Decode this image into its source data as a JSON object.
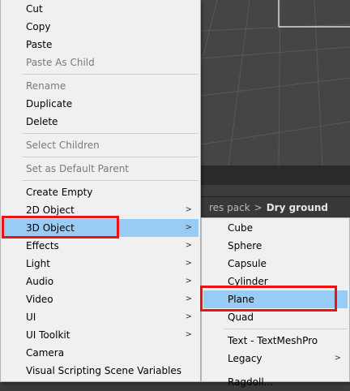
{
  "main_menu": {
    "items": [
      {
        "label": "Cut",
        "disabled": false
      },
      {
        "label": "Copy",
        "disabled": false
      },
      {
        "label": "Paste",
        "disabled": false
      },
      {
        "label": "Paste As Child",
        "disabled": true
      },
      {
        "label": "Rename",
        "disabled": true
      },
      {
        "label": "Duplicate",
        "disabled": false
      },
      {
        "label": "Delete",
        "disabled": false
      },
      {
        "label": "Select Children",
        "disabled": true
      },
      {
        "label": "Set as Default Parent",
        "disabled": true
      },
      {
        "label": "Create Empty",
        "disabled": false
      },
      {
        "label": "2D Object",
        "submenu": true
      },
      {
        "label": "3D Object",
        "submenu": true,
        "highlighted": true
      },
      {
        "label": "Effects",
        "submenu": true
      },
      {
        "label": "Light",
        "submenu": true
      },
      {
        "label": "Audio",
        "submenu": true
      },
      {
        "label": "Video",
        "submenu": true
      },
      {
        "label": "UI",
        "submenu": true
      },
      {
        "label": "UI Toolkit",
        "submenu": true
      },
      {
        "label": "Camera",
        "disabled": false
      },
      {
        "label": "Visual Scripting Scene Variables",
        "disabled": false
      }
    ]
  },
  "submenu_3d": {
    "items": [
      {
        "label": "Cube"
      },
      {
        "label": "Sphere"
      },
      {
        "label": "Capsule"
      },
      {
        "label": "Cylinder"
      },
      {
        "label": "Plane",
        "highlighted": true
      },
      {
        "label": "Quad"
      },
      {
        "label": "Text - TextMeshPro"
      },
      {
        "label": "Legacy",
        "submenu": true
      },
      {
        "label": "Ragdoll..."
      }
    ]
  },
  "breadcrumb": {
    "previous": "res pack",
    "separator": ">",
    "current": "Dry ground"
  },
  "icons": {
    "submenu_arrow": "chevron-right-icon",
    "arrow_glyph": ">"
  },
  "colors": {
    "menu_background": "#f0f0f0",
    "highlight": "#99ccf5",
    "annotation_box": "#ee1111",
    "disabled_text": "#7a7a7a",
    "scene_background": "#454545"
  }
}
